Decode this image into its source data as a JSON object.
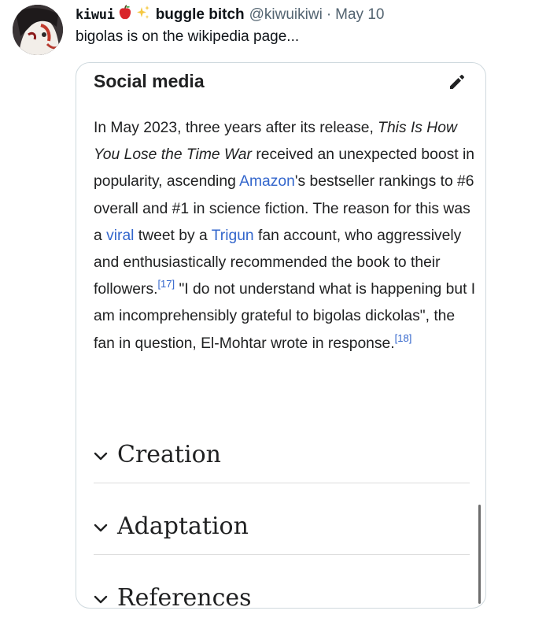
{
  "tweet": {
    "display_name_prefix": "kiwui",
    "display_name": "buggle bitch",
    "username": "@kiwuikiwi",
    "separator": "·",
    "date": "May 10",
    "text": "bigolas is on the wikipedia page..."
  },
  "wiki_card": {
    "title": "Social media",
    "paragraph": {
      "t1": "In May 2023, three years after its release, ",
      "italic": "This Is How You Lose the Time War",
      "t2": " received an unexpected boost in popularity, ascending ",
      "link_amazon": "Amazon",
      "t3": "'s bestseller rankings to #6 overall and #1 in science fiction. The reason for this was a ",
      "link_viral": "viral",
      "t4": " tweet by a ",
      "link_trigun": "Trigun",
      "t5": " fan account, who aggressively and enthusiastically recommended the book to their followers.",
      "ref1": "[17]",
      "t6": " \"I do not understand what is happening but I am incomprehensibly grateful to bigolas dickolas\", the fan in question, El-Mohtar wrote in response.",
      "ref2": "[18]"
    },
    "sections": [
      "Creation",
      "Adaptation",
      "References"
    ]
  },
  "icons": [
    "avatar",
    "apple-emoji-icon",
    "sparkles-emoji-icon",
    "edit-pencil-icon",
    "chevron-down-icon"
  ]
}
